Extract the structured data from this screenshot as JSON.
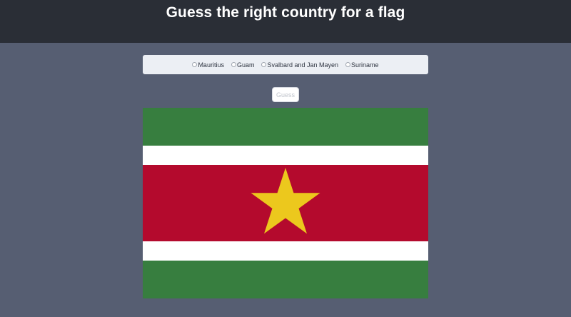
{
  "header": {
    "title": "Guess the right country for a flag"
  },
  "options": [
    {
      "label": "Mauritius",
      "selected": false
    },
    {
      "label": "Guam",
      "selected": false
    },
    {
      "label": "Svalbard and Jan Mayen",
      "selected": false
    },
    {
      "label": "Suriname",
      "selected": false
    }
  ],
  "guess_button": {
    "label": "Guess"
  },
  "flag": {
    "colors": {
      "green": "#377e3f",
      "white": "#ffffff",
      "red": "#b40a2d",
      "star": "#ecc81d"
    }
  },
  "colors": {
    "page_background": "#565e72",
    "header_background": "#2a2e36",
    "options_background": "#eceff4"
  }
}
